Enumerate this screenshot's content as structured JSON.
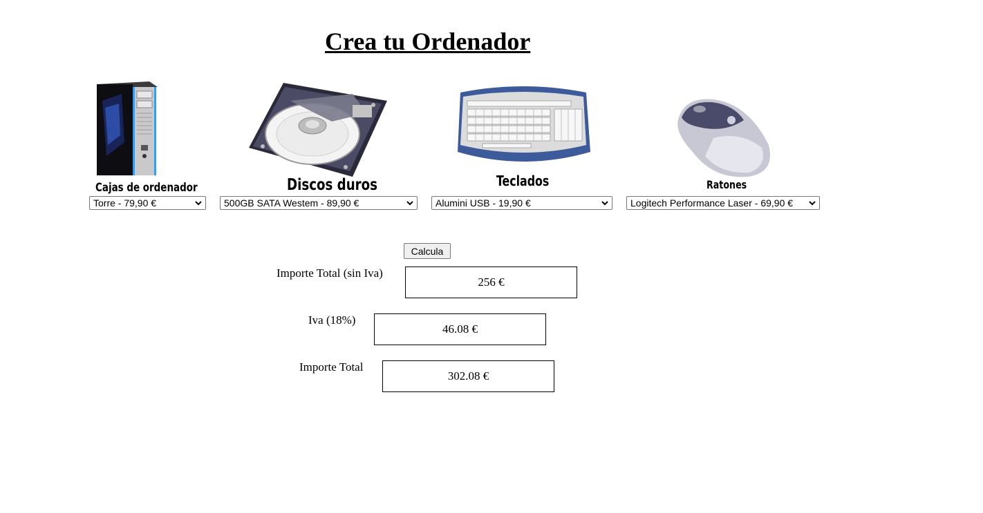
{
  "title": "Crea tu Ordenador",
  "products": [
    {
      "caption": "Cajas de ordenador",
      "image_icon": "pc-tower-icon",
      "selected": "Torre - 79,90 €"
    },
    {
      "caption": "Discos duros",
      "image_icon": "hard-drive-icon",
      "selected": "500GB SATA Westem - 89,90 €"
    },
    {
      "caption": "Teclados",
      "image_icon": "keyboard-icon",
      "selected": "Alumini USB - 19,90 €"
    },
    {
      "caption": "Ratones",
      "image_icon": "mouse-icon",
      "selected": "Logitech Performance Laser - 69,90 €"
    }
  ],
  "calculate_label": "Calcula",
  "results": [
    {
      "label": "Importe Total (sin Iva)",
      "value": "256 €"
    },
    {
      "label": "Iva (18%)",
      "value": "46.08 €"
    },
    {
      "label": "Importe Total",
      "value": "302.08 €"
    }
  ]
}
